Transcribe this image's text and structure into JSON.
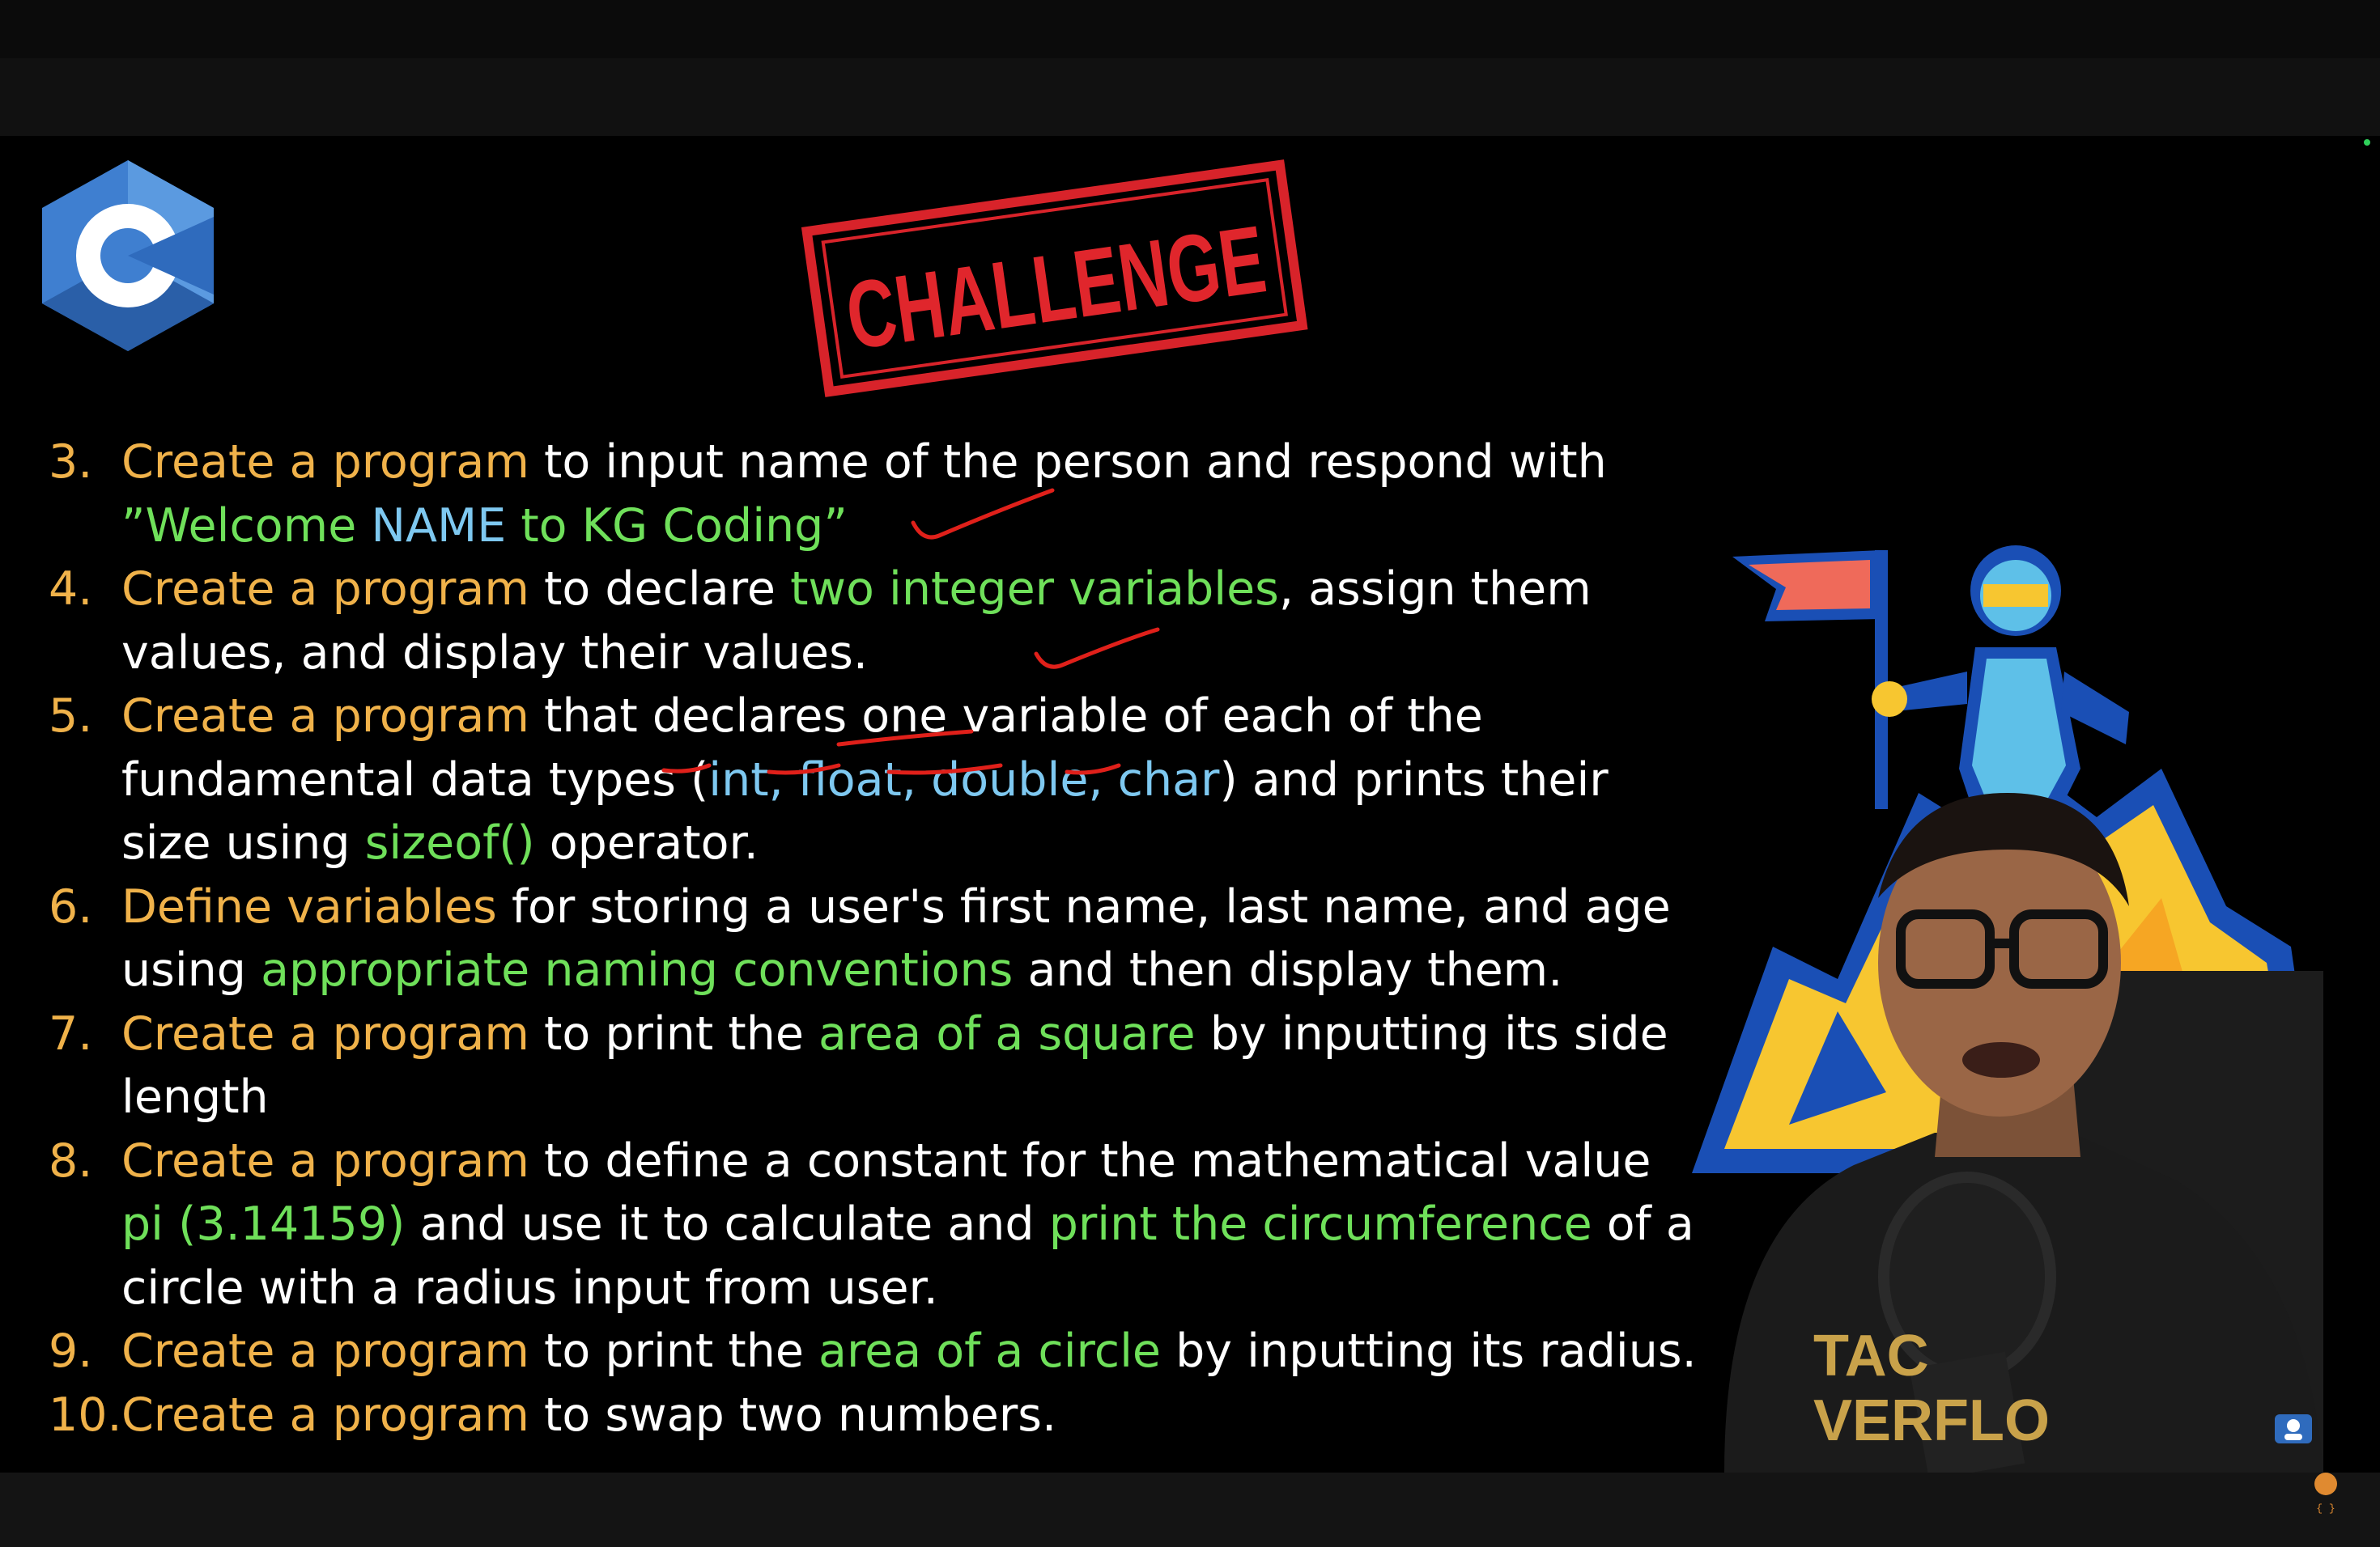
{
  "slide": {
    "stamp_text": "CHALLENGE",
    "items": [
      {
        "num": "3.",
        "l1": [
          {
            "t": "Create a program",
            "c": "o"
          },
          {
            "t": " to input name of the person and respond with",
            "c": "w"
          }
        ],
        "l2": [
          {
            "t": "”Welcome ",
            "c": "g"
          },
          {
            "t": "NAME",
            "c": "b"
          },
          {
            "t": " to KG Coding”",
            "c": "g"
          }
        ]
      },
      {
        "num": "4.",
        "l1": [
          {
            "t": "Create a program",
            "c": "o"
          },
          {
            "t": " to declare ",
            "c": "w"
          },
          {
            "t": "two integer variables",
            "c": "g"
          },
          {
            "t": ", assign them",
            "c": "w"
          }
        ],
        "l2": [
          {
            "t": "values, and display their values.",
            "c": "w"
          }
        ]
      },
      {
        "num": "5.",
        "l1": [
          {
            "t": "Create a program",
            "c": "o"
          },
          {
            "t": " that declares one variable of each of the",
            "c": "w"
          }
        ],
        "l2": [
          {
            "t": "fundamental data types (",
            "c": "w"
          },
          {
            "t": "int, float, double, char",
            "c": "b"
          },
          {
            "t": ") and prints their",
            "c": "w"
          }
        ],
        "l3": [
          {
            "t": "size using ",
            "c": "w"
          },
          {
            "t": "sizeof()",
            "c": "g"
          },
          {
            "t": " operator.",
            "c": "w"
          }
        ]
      },
      {
        "num": "6.",
        "l1": [
          {
            "t": "Define variables",
            "c": "o"
          },
          {
            "t": " for storing a user's first name, last name, and age",
            "c": "w"
          }
        ],
        "l2": [
          {
            "t": "using ",
            "c": "w"
          },
          {
            "t": "appropriate naming conventions",
            "c": "g"
          },
          {
            "t": " and then display them.",
            "c": "w"
          }
        ]
      },
      {
        "num": "7.",
        "l1": [
          {
            "t": "Create a program",
            "c": "o"
          },
          {
            "t": " to print the ",
            "c": "w"
          },
          {
            "t": "area of a square",
            "c": "g"
          },
          {
            "t": " by inputting its side",
            "c": "w"
          }
        ],
        "l2": [
          {
            "t": "length",
            "c": "w"
          }
        ]
      },
      {
        "num": "8.",
        "l1": [
          {
            "t": "Create a program",
            "c": "o"
          },
          {
            "t": " to define a constant for the mathematical value",
            "c": "w"
          }
        ],
        "l2": [
          {
            "t": "pi (3.14159)",
            "c": "g"
          },
          {
            "t": " and use it to calculate and ",
            "c": "w"
          },
          {
            "t": "print the circumference",
            "c": "g"
          },
          {
            "t": " of a",
            "c": "w"
          }
        ],
        "l3": [
          {
            "t": "circle with a radius input from user.",
            "c": "w"
          }
        ]
      },
      {
        "num": "9.",
        "l1": [
          {
            "t": "Create a program",
            "c": "o"
          },
          {
            "t": " to print the ",
            "c": "w"
          },
          {
            "t": "area of a circle",
            "c": "g"
          },
          {
            "t": " by inputting its radius.",
            "c": "w"
          }
        ]
      },
      {
        "num": "10.",
        "l1": [
          {
            "t": "Create a program",
            "c": "o"
          },
          {
            "t": " to swap two numbers",
            "c": "w"
          },
          {
            "t": ".",
            "c": "w"
          }
        ]
      }
    ],
    "shirt_text": [
      "TAC",
      "VERFLO"
    ]
  },
  "colors": {
    "orange": "#f0b24a",
    "green": "#6fe05a",
    "blue": "#7ec8f0",
    "ink": "#e0201a"
  }
}
